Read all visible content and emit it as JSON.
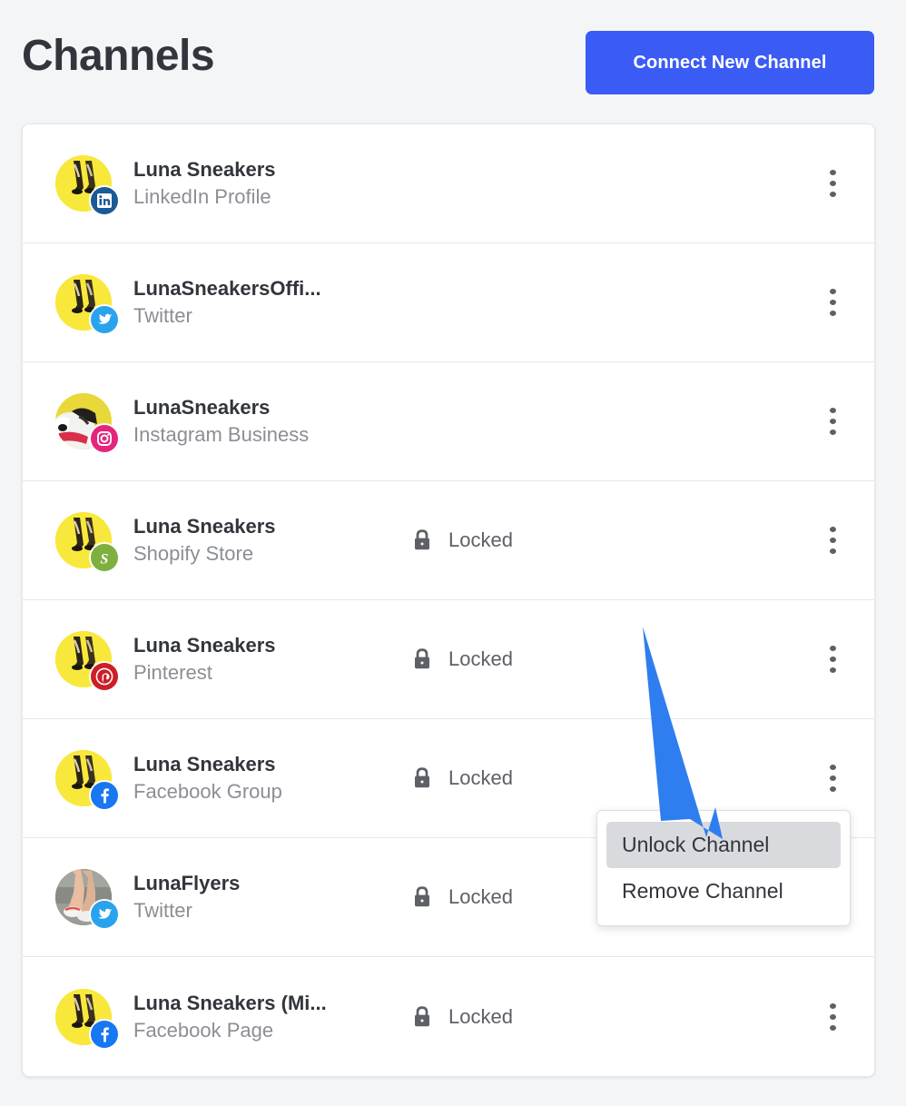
{
  "header": {
    "title": "Channels",
    "connect_button_label": "Connect New Channel",
    "accent_color": "#3b5bf5"
  },
  "channels": [
    {
      "name": "Luna Sneakers",
      "type": "LinkedIn Profile",
      "platform": "linkedin",
      "avatar": "sneakers",
      "locked": false,
      "locked_label": "",
      "menu_icon": "kebab-menu-icon"
    },
    {
      "name": "LunaSneakersOffi...",
      "type": "Twitter",
      "platform": "twitter",
      "avatar": "sneakers",
      "locked": false,
      "locked_label": "",
      "menu_icon": "kebab-menu-icon"
    },
    {
      "name": "LunaSneakers",
      "type": "Instagram Business",
      "platform": "instagram",
      "avatar": "dog",
      "locked": false,
      "locked_label": "",
      "menu_icon": "kebab-menu-icon"
    },
    {
      "name": "Luna Sneakers",
      "type": "Shopify Store",
      "platform": "shopify",
      "avatar": "sneakers",
      "locked": true,
      "locked_label": "Locked",
      "menu_icon": "kebab-menu-icon"
    },
    {
      "name": "Luna Sneakers",
      "type": "Pinterest",
      "platform": "pinterest",
      "avatar": "sneakers",
      "locked": true,
      "locked_label": "Locked",
      "menu_icon": "kebab-menu-icon"
    },
    {
      "name": "Luna Sneakers",
      "type": "Facebook Group",
      "platform": "facebook",
      "avatar": "sneakers",
      "locked": true,
      "locked_label": "Locked",
      "menu_icon": "kebab-menu-icon"
    },
    {
      "name": "LunaFlyers",
      "type": "Twitter",
      "platform": "twitter",
      "avatar": "legs",
      "locked": true,
      "locked_label": "Locked",
      "menu_icon": "kebab-menu-icon"
    },
    {
      "name": "Luna Sneakers (Mi...",
      "type": "Facebook Page",
      "platform": "facebook",
      "avatar": "sneakers",
      "locked": true,
      "locked_label": "Locked",
      "menu_icon": "kebab-menu-icon"
    }
  ],
  "dropdown": {
    "items": [
      {
        "label": "Unlock Channel",
        "highlighted": true
      },
      {
        "label": "Remove Channel",
        "highlighted": false
      }
    ]
  },
  "annotation": {
    "type": "arrow",
    "color": "#2f7ef0",
    "points_to": "Unlock Channel"
  },
  "platform_colors": {
    "linkedin": "#1a5a97",
    "twitter": "#2aa3ef",
    "instagram": "#e4257d",
    "shopify": "#7fb03f",
    "pinterest": "#cc1f27",
    "facebook": "#1877f2"
  }
}
